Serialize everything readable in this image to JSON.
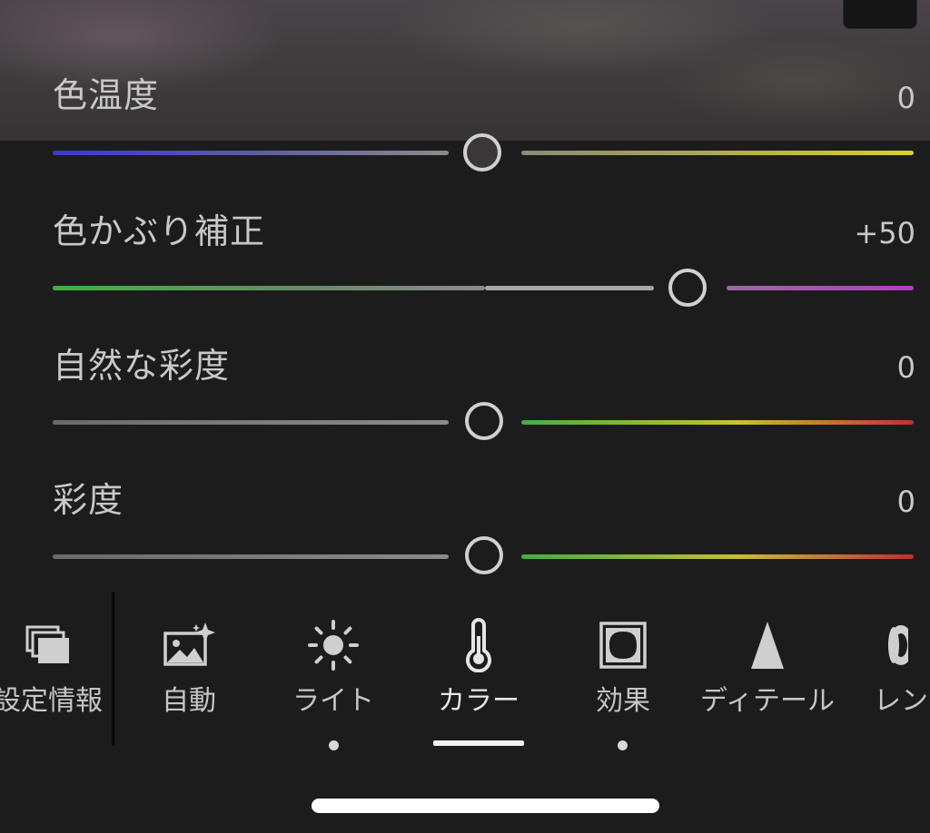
{
  "sliders": [
    {
      "label": "色温度",
      "value": "0",
      "position": 0.5
    },
    {
      "label": "色かぶり補正",
      "value": "+50",
      "position": 0.75
    },
    {
      "label": "自然な彩度",
      "value": "0",
      "position": 0.5
    },
    {
      "label": "彩度",
      "value": "0",
      "position": 0.5
    }
  ],
  "toolbar": {
    "items": [
      {
        "label": "設定情報",
        "icon": "presets-icon"
      },
      {
        "label": "自動",
        "icon": "auto-image-sparkle-icon"
      },
      {
        "label": "ライト",
        "icon": "sun-icon"
      },
      {
        "label": "カラー",
        "icon": "thermometer-icon"
      },
      {
        "label": "効果",
        "icon": "vignette-icon"
      },
      {
        "label": "ディテール",
        "icon": "triangle-icon"
      },
      {
        "label": "レンズ",
        "icon": "lens-icon"
      }
    ],
    "active_item": "カラー"
  },
  "colors": {
    "background": "#1c1c1c",
    "text": "#c8c8c8",
    "temperature_gradient": [
      "#3a3ad0",
      "#7a7a7a",
      "#d8d030"
    ],
    "tint_gradient": [
      "#40b040",
      "#909090",
      "#b040c0"
    ],
    "saturation_gradient": [
      "#707070",
      "#40b040",
      "#d0c030",
      "#c03030"
    ]
  }
}
